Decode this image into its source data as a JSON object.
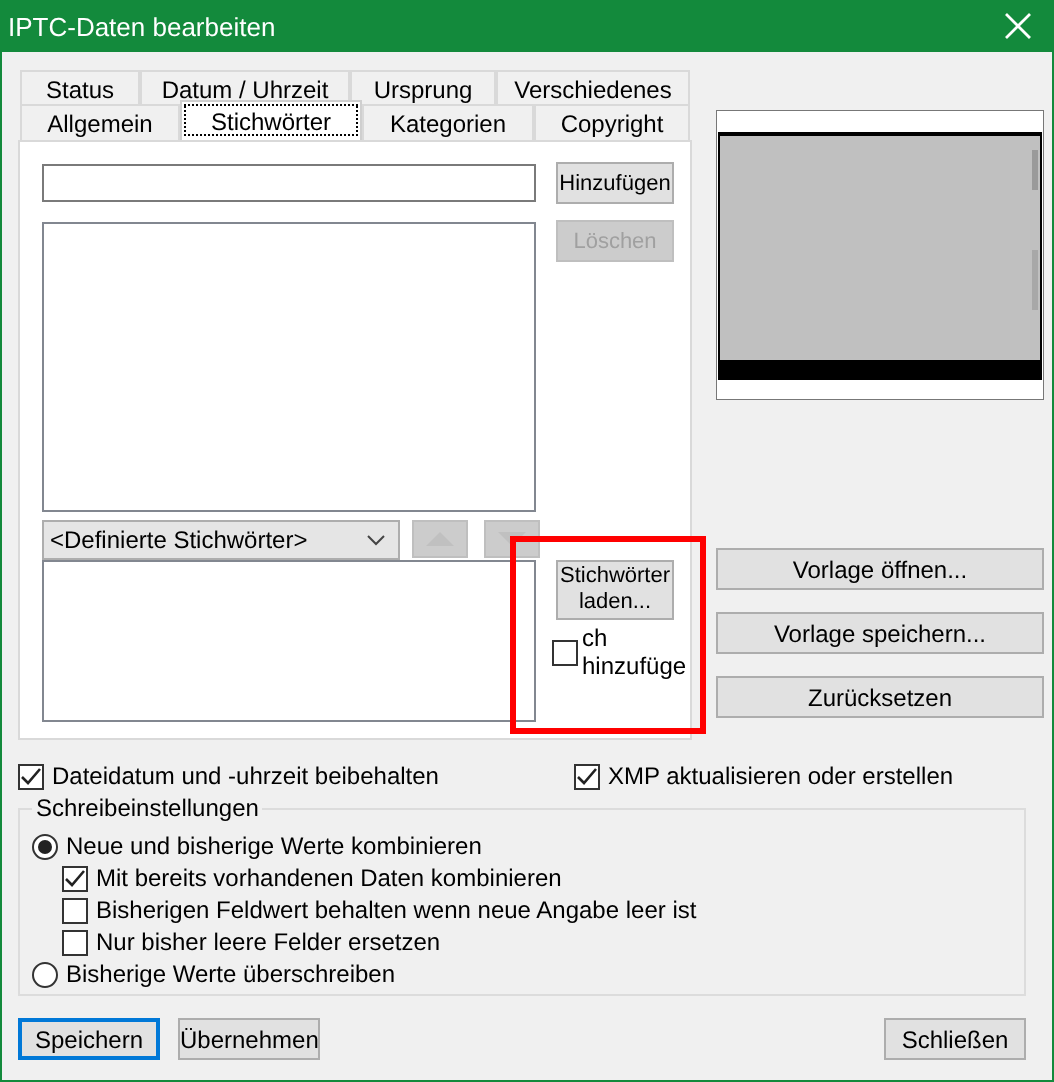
{
  "window": {
    "title": "IPTC-Daten bearbeiten"
  },
  "tabs": [
    [
      {
        "label": "Status",
        "selected": false
      },
      {
        "label": "Datum / Uhrzeit",
        "selected": false
      },
      {
        "label": "Ursprung",
        "selected": false
      },
      {
        "label": "Verschiedenes",
        "selected": false
      }
    ],
    [
      {
        "label": "Allgemein",
        "selected": false
      },
      {
        "label": "Stichwörter",
        "selected": true
      },
      {
        "label": "Kategorien",
        "selected": false
      },
      {
        "label": "Copyright",
        "selected": false
      }
    ]
  ],
  "keywords": {
    "add_button": {
      "label": "Hinzufügen",
      "disabled": false
    },
    "delete_button": {
      "label": "Löschen",
      "disabled": true
    },
    "source": {
      "value": "<Definierte Stichwörter>"
    },
    "move_up": {
      "disabled": true
    },
    "move_down": {
      "disabled": true
    },
    "load_button": {
      "label": "Stichwörter laden...",
      "disabled": false
    },
    "auto_add": {
      "label": "ch hinzufüge",
      "checked": false
    }
  },
  "template_buttons": [
    "Vorlage öffnen...",
    "Vorlage speichern...",
    "Zurücksetzen"
  ],
  "options": [
    {
      "label": "Dateidatum und -uhrzeit beibehalten",
      "checked": true
    },
    {
      "label": "XMP aktualisieren oder erstellen",
      "checked": true
    }
  ],
  "write_settings": {
    "title": "Schreibeinstellungen",
    "items": [
      {
        "label": "Neue und bisherige Werte kombinieren",
        "selected": true,
        "children": [
          {
            "label": "Mit bereits vorhandenen Daten kombinieren",
            "checked": true
          },
          {
            "label": "Bisherigen Feldwert behalten wenn neue Angabe leer ist",
            "checked": false
          },
          {
            "label": "Nur bisher leere Felder ersetzen",
            "checked": false
          }
        ]
      },
      {
        "label": "Bisherige Werte überschreiben",
        "selected": false
      }
    ]
  },
  "footer": {
    "left": [
      {
        "label": "Speichern",
        "default": true
      },
      {
        "label": "Übernehmen",
        "default": false
      }
    ],
    "right": [
      {
        "label": "Schließen",
        "default": false
      }
    ]
  },
  "highlight": {
    "shown": true
  }
}
